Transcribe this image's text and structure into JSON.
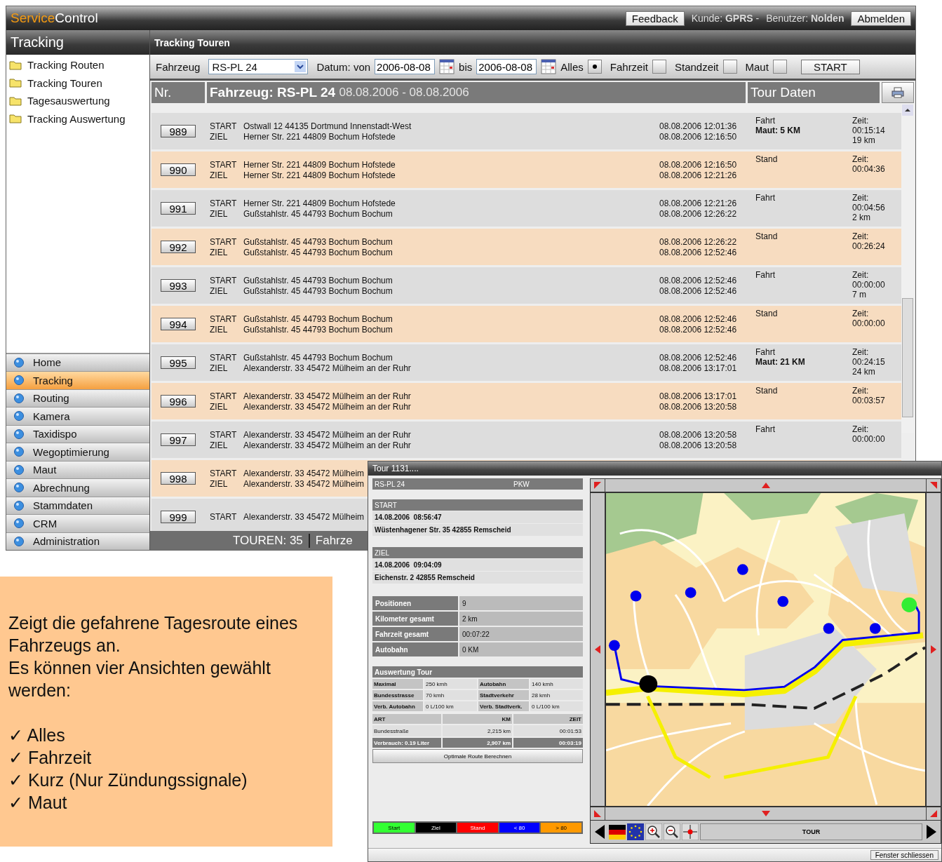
{
  "header": {
    "logo_accent": "Service",
    "logo_rest": "Control",
    "feedback": "Feedback",
    "customer": "Kunde: **GPRS** -",
    "user": "Benutzer: **Nolden**",
    "logout": "Abmelden"
  },
  "sidebar": {
    "title": "Tracking",
    "items": [
      {
        "label": "Tracking Routen"
      },
      {
        "label": "Tracking Touren"
      },
      {
        "label": "Tagesauswertung"
      },
      {
        "label": "Tracking Auswertung"
      }
    ],
    "nav": [
      {
        "label": "Home",
        "selected": false
      },
      {
        "label": "Tracking",
        "selected": true
      },
      {
        "label": "Routing",
        "selected": false
      },
      {
        "label": "Kamera",
        "selected": false
      },
      {
        "label": "Taxidispo",
        "selected": false
      },
      {
        "label": "Wegoptimierung",
        "selected": false
      },
      {
        "label": "Maut",
        "selected": false
      },
      {
        "label": "Abrechnung",
        "selected": false
      },
      {
        "label": "Stammdaten",
        "selected": false
      },
      {
        "label": "CRM",
        "selected": false
      },
      {
        "label": "Administration",
        "selected": false
      }
    ]
  },
  "content": {
    "title": "Tracking Touren",
    "filter": {
      "vehicle_label": "Fahrzeug",
      "vehicle": "RS-PL 24",
      "date_label": "Datum: von",
      "from": "2006-08-08",
      "to_label": "bis",
      "to": "2006-08-08",
      "options": [
        {
          "label": "Alles",
          "selected": true
        },
        {
          "label": "Fahrzeit",
          "selected": false
        },
        {
          "label": "Standzeit",
          "selected": false
        },
        {
          "label": "Maut",
          "selected": false
        }
      ],
      "start": "START"
    },
    "table": {
      "nr_header": "Nr.",
      "title": "Fahrzeug: RS-PL 24",
      "range": "08.08.2006 - 08.08.2006",
      "data_header": "Tour Daten",
      "rows": [
        {
          "nr": "989",
          "start": {
            "label": "START",
            "address": "Ostwall 12 44135 Dortmund Innenstadt-West",
            "time": "08.08.2006 12:01:36"
          },
          "end": {
            "label": "ZIEL",
            "address": "Herner Str. 221 44809 Bochum Hofstede",
            "time": "08.08.2006 12:16:50"
          },
          "status": "Fahrt",
          "maut": "Maut: 5 KM",
          "zeit_label": "Zeit:",
          "duration": "00:15:14",
          "distance": "19 km"
        },
        {
          "nr": "990",
          "start": {
            "label": "START",
            "address": "Herner Str. 221 44809 Bochum Hofstede",
            "time": "08.08.2006 12:16:50"
          },
          "end": {
            "label": "ZIEL",
            "address": "Herner Str. 221 44809 Bochum Hofstede",
            "time": "08.08.2006 12:21:26"
          },
          "status": "Stand",
          "zeit_label": "Zeit:",
          "duration": "00:04:36"
        },
        {
          "nr": "991",
          "start": {
            "label": "START",
            "address": "Herner Str. 221 44809 Bochum Hofstede",
            "time": "08.08.2006 12:21:26"
          },
          "end": {
            "label": "ZIEL",
            "address": "Gußstahlstr. 45 44793 Bochum Bochum",
            "time": "08.08.2006 12:26:22"
          },
          "status": "Fahrt",
          "zeit_label": "Zeit:",
          "duration": "00:04:56",
          "distance": "2 km"
        },
        {
          "nr": "992",
          "start": {
            "label": "START",
            "address": "Gußstahlstr. 45 44793 Bochum Bochum",
            "time": "08.08.2006 12:26:22"
          },
          "end": {
            "label": "ZIEL",
            "address": "Gußstahlstr. 45 44793 Bochum Bochum",
            "time": "08.08.2006 12:52:46"
          },
          "status": "Stand",
          "zeit_label": "Zeit:",
          "duration": "00:26:24"
        },
        {
          "nr": "993",
          "start": {
            "label": "START",
            "address": "Gußstahlstr. 45 44793 Bochum Bochum",
            "time": "08.08.2006 12:52:46"
          },
          "end": {
            "label": "ZIEL",
            "address": "Gußstahlstr. 45 44793 Bochum Bochum",
            "time": "08.08.2006 12:52:46"
          },
          "status": "Fahrt",
          "zeit_label": "Zeit:",
          "duration": "00:00:00",
          "distance": "7 m"
        },
        {
          "nr": "994",
          "start": {
            "label": "START",
            "address": "Gußstahlstr. 45 44793 Bochum Bochum",
            "time": "08.08.2006 12:52:46"
          },
          "end": {
            "label": "ZIEL",
            "address": "Gußstahlstr. 45 44793 Bochum Bochum",
            "time": "08.08.2006 12:52:46"
          },
          "status": "Stand",
          "zeit_label": "Zeit:",
          "duration": "00:00:00"
        },
        {
          "nr": "995",
          "start": {
            "label": "START",
            "address": "Gußstahlstr. 45 44793 Bochum Bochum",
            "time": "08.08.2006 12:52:46"
          },
          "end": {
            "label": "ZIEL",
            "address": "Alexanderstr. 33 45472 Mülheim an der Ruhr",
            "time": "08.08.2006 13:17:01"
          },
          "status": "Fahrt",
          "maut": "Maut: 21 KM",
          "zeit_label": "Zeit:",
          "duration": "00:24:15",
          "distance": "24 km"
        },
        {
          "nr": "996",
          "start": {
            "label": "START",
            "address": "Alexanderstr. 33 45472 Mülheim an der Ruhr",
            "time": "08.08.2006 13:17:01"
          },
          "end": {
            "label": "ZIEL",
            "address": "Alexanderstr. 33 45472 Mülheim an der Ruhr",
            "time": "08.08.2006 13:20:58"
          },
          "status": "Stand",
          "zeit_label": "Zeit:",
          "duration": "00:03:57"
        },
        {
          "nr": "997",
          "start": {
            "label": "START",
            "address": "Alexanderstr. 33 45472 Mülheim an der Ruhr",
            "time": "08.08.2006 13:20:58"
          },
          "end": {
            "label": "ZIEL",
            "address": "Alexanderstr. 33 45472 Mülheim an der Ruhr",
            "time": "08.08.2006 13:20:58"
          },
          "status": "Fahrt",
          "zeit_label": "Zeit:",
          "duration": "00:00:00"
        },
        {
          "nr": "998",
          "start": {
            "label": "START",
            "address": "Alexanderstr. 33 45472 Mülheim"
          },
          "end": {
            "label": "ZIEL",
            "address": "Alexanderstr. 33 45472 Mülheim"
          }
        },
        {
          "nr": "999",
          "start": {
            "label": "START",
            "address": "Alexanderstr. 33 45472 Mülheim"
          }
        }
      ]
    },
    "footer": [
      "TOUREN: 35",
      "Fahrze"
    ]
  },
  "popup": {
    "title": "Tour 1131....",
    "vehicle": "RS-PL 24",
    "type": "PKW",
    "start": {
      "label": "START",
      "time": "14.08.2006  08:56:47",
      "address": "Wüstenhagener Str. 35 42855 Remscheid"
    },
    "end": {
      "label": "ZIEL",
      "time": "14.08.2006  09:04:09",
      "address": "Eichenstr. 2 42855 Remscheid"
    },
    "stats": [
      {
        "label": "Positionen",
        "value": "9"
      },
      {
        "label": "Kilometer gesamt",
        "value": "2 km"
      },
      {
        "label": "Fahrzeit gesamt",
        "value": "00:07:22"
      },
      {
        "label": "Autobahn",
        "value": "0 KM"
      }
    ],
    "eval_title": "Auswertung Tour",
    "eval": [
      [
        "Maximal",
        "250 kmh",
        "Autobahn",
        "140 kmh"
      ],
      [
        "Bundesstrasse",
        "70 kmh",
        "Stadtverkehr",
        "28 kmh"
      ],
      [
        "Verb. Autobahn",
        "0 L/100 km",
        "Verb. Stadtverk.",
        "0 L/100 km"
      ]
    ],
    "art_header": [
      "ART",
      "KM",
      "ZEIT"
    ],
    "art_rows": [
      [
        "Bundesstraße",
        "2,215 km",
        "00:01:53"
      ]
    ],
    "art_total": [
      "Verbrauch: 0.19 Liter",
      "2,907 km",
      "00:03:19"
    ],
    "route_button": "Optimale Route Berechnen",
    "legend": [
      {
        "label": "Start",
        "color": "#33ff33"
      },
      {
        "label": "Ziel",
        "color": "#000000"
      },
      {
        "label": "Stand",
        "color": "#ff0000"
      },
      {
        "label": "< 80",
        "color": "#0000ff"
      },
      {
        "label": "> 80",
        "color": "#ff9900"
      }
    ],
    "tour_label": "TOUR",
    "close": "Fenster schliessen"
  },
  "info": {
    "paragraphs": [
      "Zeigt die gefahrene Tagesroute eines Fahrzeugs an.",
      "Es können vier Ansichten gewählt werden:"
    ],
    "checks": [
      "✓ Alles",
      "✓ Fahrzeit",
      "✓ Kurz (Nur Zündungssignale)",
      "✓ Maut"
    ]
  }
}
